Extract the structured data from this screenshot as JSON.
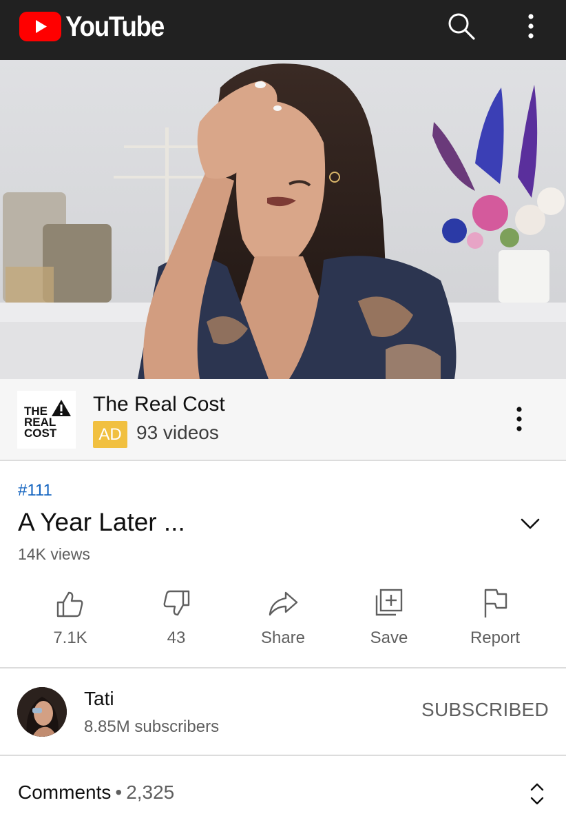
{
  "app": {
    "logo_text": "YouTube",
    "brand_color": "#ff0000",
    "bar_color": "#212121"
  },
  "icons": {
    "search": "search-icon",
    "more": "more-vert-icon",
    "expand": "chevron-down-icon",
    "like": "thumb-up-icon",
    "dislike": "thumb-down-icon",
    "share": "share-icon",
    "save": "playlist-add-icon",
    "report": "flag-icon",
    "sort": "unfold-icon"
  },
  "ad": {
    "logo_lines": [
      "THE",
      "REAL",
      "COST"
    ],
    "title": "The Real Cost",
    "badge": "AD",
    "badge_color": "#f1c040",
    "videos": "93 videos"
  },
  "video": {
    "hashtag": "#111",
    "title": "A Year Later ...",
    "views": "14K views"
  },
  "actions": [
    {
      "label": "7.1K"
    },
    {
      "label": "43"
    },
    {
      "label": "Share"
    },
    {
      "label": "Save"
    },
    {
      "label": "Report"
    }
  ],
  "channel": {
    "name": "Tati",
    "subscribers": "8.85M subscribers",
    "subscribe_state": "SUBSCRIBED"
  },
  "comments": {
    "label": "Comments",
    "separator": "•",
    "count": "2,325"
  }
}
